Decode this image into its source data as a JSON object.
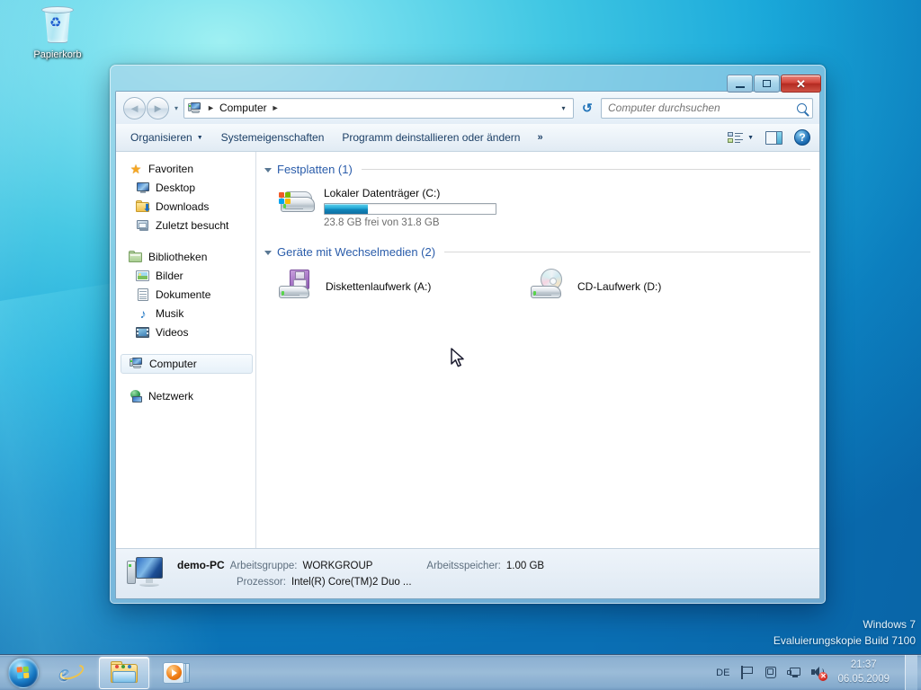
{
  "desktop": {
    "recycle_bin_label": "Papierkorb",
    "watermark_line1": "Windows 7",
    "watermark_line2": "Evaluierungskopie Build 7100"
  },
  "window": {
    "controls": {
      "minimize": "minimize-button",
      "maximize": "maximize-button",
      "close_glyph": "✕"
    },
    "nav": {
      "back_glyph": "◄",
      "forward_glyph": "►",
      "history_glyph": "▾"
    },
    "address": {
      "crumb_root": "Computer",
      "separator": "►",
      "dropdown_glyph": "▾",
      "refresh_glyph": "↻"
    },
    "search": {
      "placeholder": "Computer durchsuchen",
      "value": ""
    },
    "toolbar": {
      "organize": "Organisieren",
      "organize_caret": "▼",
      "system_properties": "Systemeigenschaften",
      "uninstall": "Programm deinstallieren oder ändern",
      "overflow": "»",
      "view_caret": "▼"
    }
  },
  "navpane": {
    "groups": [
      {
        "header": "Favoriten",
        "items": [
          "Desktop",
          "Downloads",
          "Zuletzt besucht"
        ]
      },
      {
        "header": "Bibliotheken",
        "items": [
          "Bilder",
          "Dokumente",
          "Musik",
          "Videos"
        ]
      }
    ],
    "selected": "Computer",
    "network": "Netzwerk"
  },
  "main": {
    "sections": [
      {
        "title": "Festplatten (1)",
        "drives": [
          {
            "name": "Lokaler Datenträger (C:)",
            "free_text": "23.8 GB frei von 31.8 GB",
            "free_gb": 23.8,
            "total_gb": 31.8,
            "used_percent": 25
          }
        ]
      },
      {
        "title": "Geräte mit Wechselmedien (2)",
        "devices": [
          {
            "name": "Diskettenlaufwerk (A:)",
            "icon": "floppy-drive-icon"
          },
          {
            "name": "CD-Laufwerk (D:)",
            "icon": "cd-drive-icon"
          }
        ]
      }
    ]
  },
  "status": {
    "pc_name": "demo-PC",
    "workgroup_label": "Arbeitsgruppe:",
    "workgroup_value": "WORKGROUP",
    "memory_label": "Arbeitsspeicher:",
    "memory_value": "1.00 GB",
    "cpu_label": "Prozessor:",
    "cpu_value": "Intel(R) Core(TM)2 Duo ..."
  },
  "taskbar": {
    "start": "start-orb",
    "buttons": [
      {
        "name": "internet-explorer",
        "active": false
      },
      {
        "name": "windows-explorer",
        "active": true
      },
      {
        "name": "windows-media-player",
        "active": false
      }
    ],
    "tray": {
      "language": "DE",
      "icons": [
        "flag-icon",
        "action-center-icon",
        "network-icon",
        "speaker-muted-icon"
      ],
      "time": "21:37",
      "date": "06.05.2009"
    }
  },
  "colors": {
    "accent": "#2a5caa",
    "capacity_fill": "#23a7d4",
    "close_button": "#c0392b",
    "desktop_top": "#6fdced",
    "desktop_bottom": "#0a6fb4"
  }
}
